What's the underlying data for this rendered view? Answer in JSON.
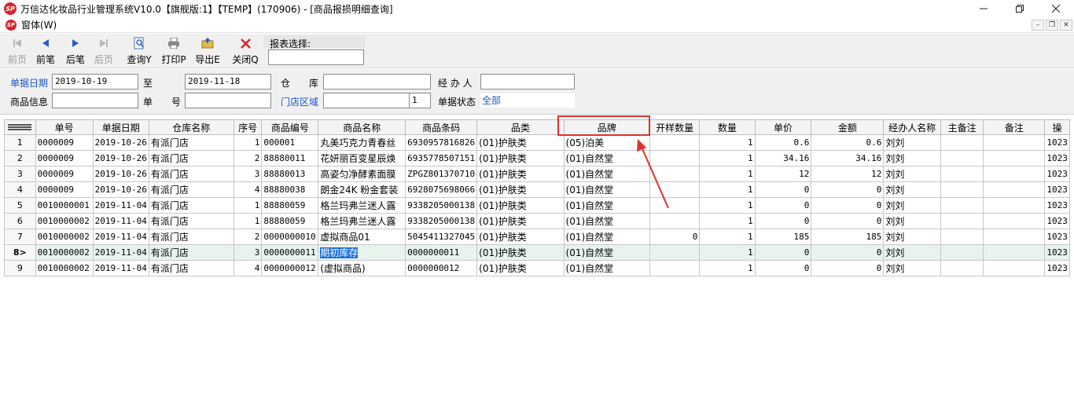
{
  "window": {
    "title": "万信达化妆品行业管理系统V10.0【旗舰版:1】【TEMP】(170906) - [商品报损明细查询]",
    "logo_text": "SP"
  },
  "menubar": {
    "item": "窗体(W)"
  },
  "toolbar": {
    "buttons": [
      {
        "label": "前页",
        "icon": "first-page-icon",
        "enabled": false
      },
      {
        "label": "前笔",
        "icon": "prev-record-icon",
        "enabled": true
      },
      {
        "label": "后笔",
        "icon": "next-record-icon",
        "enabled": true
      },
      {
        "label": "后页",
        "icon": "last-page-icon",
        "enabled": false
      },
      {
        "label": "查询Y",
        "icon": "query-icon",
        "enabled": true
      },
      {
        "label": "打印P",
        "icon": "print-icon",
        "enabled": true
      },
      {
        "label": "导出E",
        "icon": "export-icon",
        "enabled": true
      },
      {
        "label": "关闭Q",
        "icon": "close-icon",
        "enabled": true
      }
    ],
    "report_select_label": "报表选择:",
    "report_select_value": ""
  },
  "filter": {
    "date_label": "单据日期",
    "date_from": "2019-10-19",
    "to_label": "至",
    "date_to": "2019-11-18",
    "warehouse_label": "仓　　库",
    "warehouse_value": "",
    "handler_label": "经 办 人",
    "handler_value": "",
    "product_label": "商品信息",
    "product_value": "",
    "doc_no_label": "单　　号",
    "doc_no_value": "",
    "store_area_label": "门店区域",
    "store_area_value": "",
    "store_area_code": "1",
    "doc_status_label": "单据状态",
    "doc_status_value": "全部"
  },
  "grid": {
    "columns": [
      "单号",
      "单据日期",
      "仓库名称",
      "序号",
      "商品编号",
      "商品名称",
      "商品条码",
      "品类",
      "品牌",
      "开样数量",
      "数量",
      "单价",
      "金额",
      "经办人名称",
      "主备注",
      "备注",
      "操"
    ],
    "rows": [
      {
        "rn": "1",
        "cells": [
          "0000009",
          "2019-10-26",
          "有派门店",
          "1",
          "000001",
          "丸美巧克力青春丝",
          "6930957816826",
          "(01)护肤类",
          "(05)泊美",
          "",
          "1",
          "0.6",
          "0.6",
          "刘刘",
          "",
          "",
          "1023"
        ]
      },
      {
        "rn": "2",
        "cells": [
          "0000009",
          "2019-10-26",
          "有派门店",
          "2",
          "88880011",
          "花妍丽百变星辰焕",
          "6935778507151",
          "(01)护肤类",
          "(01)自然堂",
          "",
          "1",
          "34.16",
          "34.16",
          "刘刘",
          "",
          "",
          "1023"
        ]
      },
      {
        "rn": "3",
        "cells": [
          "0000009",
          "2019-10-26",
          "有派门店",
          "3",
          "88880013",
          "高姿匀净酵素面膜",
          "ZPGZ801370710",
          "(01)护肤类",
          "(01)自然堂",
          "",
          "1",
          "12",
          "12",
          "刘刘",
          "",
          "",
          "1023"
        ]
      },
      {
        "rn": "4",
        "cells": [
          "0000009",
          "2019-10-26",
          "有派门店",
          "4",
          "88880038",
          "朗金24K 粉金套装",
          "6928075698066",
          "(01)护肤类",
          "(01)自然堂",
          "",
          "1",
          "0",
          "0",
          "刘刘",
          "",
          "",
          "1023"
        ]
      },
      {
        "rn": "5",
        "cells": [
          "0010000001",
          "2019-11-04",
          "有派门店",
          "1",
          "88880059",
          "格兰玛弗兰迷人露",
          "9338205000138",
          "(01)护肤类",
          "(01)自然堂",
          "",
          "1",
          "0",
          "0",
          "刘刘",
          "",
          "",
          "1023"
        ]
      },
      {
        "rn": "6",
        "cells": [
          "0010000002",
          "2019-11-04",
          "有派门店",
          "1",
          "88880059",
          "格兰玛弗兰迷人露",
          "9338205000138",
          "(01)护肤类",
          "(01)自然堂",
          "",
          "1",
          "0",
          "0",
          "刘刘",
          "",
          "",
          "1023"
        ]
      },
      {
        "rn": "7",
        "cells": [
          "0010000002",
          "2019-11-04",
          "有派门店",
          "2",
          "0000000010",
          "虚拟商品01",
          "5045411327045",
          "(01)护肤类",
          "(01)自然堂",
          "0",
          "1",
          "185",
          "185",
          "刘刘",
          "",
          "",
          "1023"
        ]
      },
      {
        "rn": "8>",
        "cells": [
          "0010000002",
          "2019-11-04",
          "有派门店",
          "3",
          "0000000011",
          "期初库存",
          "0000000011",
          "(01)护肤类",
          "(01)自然堂",
          "",
          "1",
          "0",
          "0",
          "刘刘",
          "",
          "",
          "1023"
        ]
      },
      {
        "rn": "9",
        "cells": [
          "0010000002",
          "2019-11-04",
          "有派门店",
          "4",
          "0000000012",
          "(虚拟商品)",
          "0000000012",
          "(01)护肤类",
          "(01)自然堂",
          "",
          "1",
          "0",
          "0",
          "刘刘",
          "",
          "",
          "1023"
        ]
      }
    ],
    "active_row_index": 7
  },
  "annotation": {
    "color": "#e0312d"
  }
}
